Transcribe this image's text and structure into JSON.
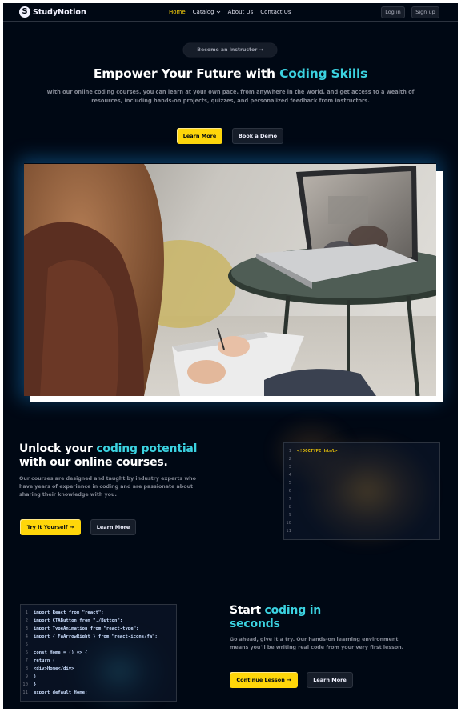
{
  "brand": {
    "logo_letter": "S",
    "name": "StudyNotion"
  },
  "nav": {
    "links": [
      "Home",
      "Catalog",
      "About Us",
      "Contact Us"
    ],
    "active": "Home",
    "login": "Log in",
    "signup": "Sign up"
  },
  "hero": {
    "pill": "Become an Instructor",
    "title_plain": "Empower Your Future with ",
    "title_highlight": "Coding Skills",
    "subtitle": "With our online coding courses, you can learn at your own pace, from anywhere in the world, and get access to a wealth of resources, including hands-on projects, quizzes, and personalized feedback from instructors.",
    "cta_primary": "Learn More",
    "cta_secondary": "Book a Demo"
  },
  "section1": {
    "title_a": "Unlock your ",
    "title_highlight": "coding potential",
    "title_b": " with our online courses.",
    "text": "Our courses are designed and taught by industry experts who have years of experience in coding and are passionate about sharing their knowledge with you.",
    "cta_primary": "Try it Yourself",
    "cta_secondary": "Learn More",
    "code_numbers": [
      "1",
      "2",
      "3",
      "4",
      "5",
      "6",
      "7",
      "8",
      "9",
      "10",
      "11"
    ],
    "code_lines": [
      "<!DOCTYPE html>",
      "",
      "",
      "",
      "",
      "",
      "",
      "",
      "",
      "",
      ""
    ]
  },
  "section2": {
    "title_a": "Start ",
    "title_highlight": "coding in seconds",
    "text": "Go ahead, give it a try. Our hands-on learning environment means you'll be writing real code from your very first lesson.",
    "cta_primary": "Continue Lesson",
    "cta_secondary": "Learn More",
    "code_numbers": [
      "1",
      "2",
      "3",
      "4",
      "5",
      "6",
      "7",
      "8",
      "9",
      "10",
      "11"
    ],
    "code_lines": [
      "import React from \"react\";",
      "import CTAButton from \"./Button\";",
      "import TypeAnimation from \"react-type\";",
      "import { FaArrowRight } from \"react-icons/fa\";",
      "",
      "const Home = () => {",
      "return (",
      "<div>Home</div>",
      ")",
      "}",
      "export default Home;"
    ]
  },
  "colors": {
    "background": "#000814",
    "accent": "#FFD60A",
    "highlight": "#3BD2E0"
  },
  "icons": {
    "arrow": "arrow-right-icon",
    "chevron": "chevron-down-icon"
  }
}
